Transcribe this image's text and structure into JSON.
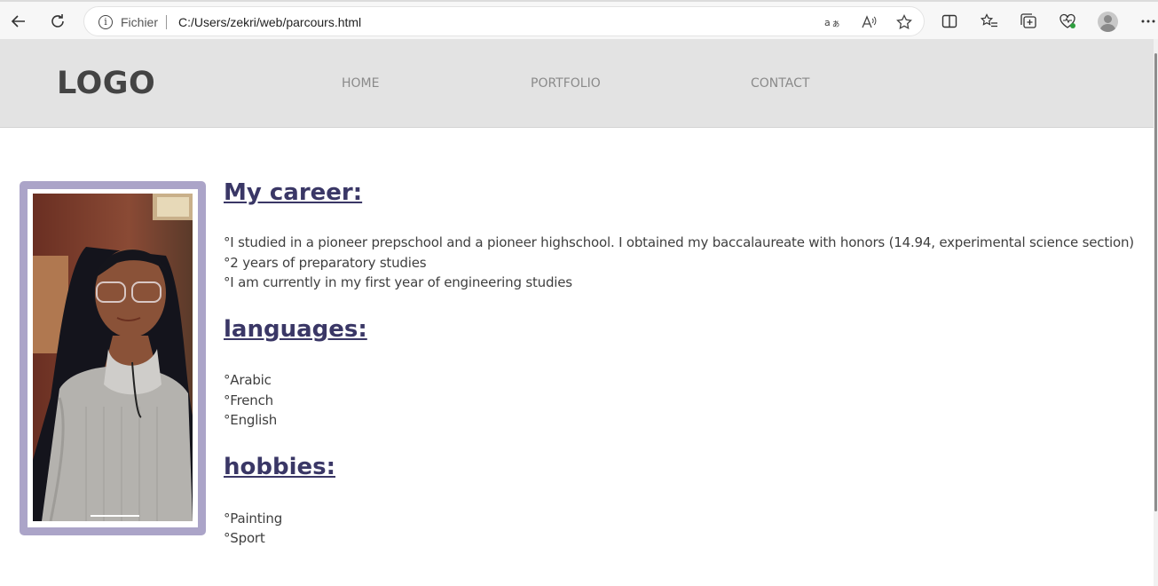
{
  "browser": {
    "address_label": "Fichier",
    "url": "C:/Users/zekri/web/parcours.html"
  },
  "header": {
    "logo": "LOGO",
    "nav": [
      {
        "label": "HOME"
      },
      {
        "label": "PORTFOLIO"
      },
      {
        "label": "CONTACT"
      }
    ]
  },
  "career": {
    "title": "My career:",
    "items": [
      "°I studied in a pioneer prepschool and a pioneer highschool. I obtained my baccalaureate with honors (14.94, experimental science section)",
      "°2 years of preparatory studies",
      "°I am currently in my first year of engineering studies"
    ]
  },
  "languages": {
    "title": "languages:",
    "items": [
      "°Arabic",
      "°French",
      "°English"
    ]
  },
  "hobbies": {
    "title": "hobbies:",
    "items": [
      "°Painting",
      "°Sport"
    ]
  },
  "colors": {
    "heading": "#3a3766",
    "frame": "#aba4c8",
    "header_bg": "#e3e3e3"
  }
}
